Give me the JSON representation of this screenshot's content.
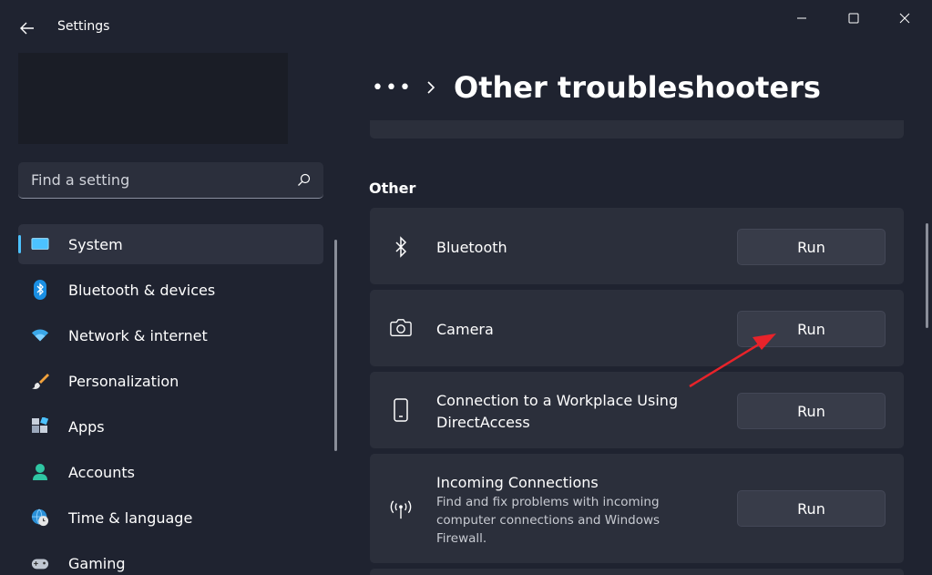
{
  "app": {
    "title": "Settings"
  },
  "search": {
    "placeholder": "Find a setting"
  },
  "sidebar": {
    "items": [
      {
        "label": "System",
        "icon": "monitor-icon",
        "active": true
      },
      {
        "label": "Bluetooth & devices",
        "icon": "bluetooth-icon"
      },
      {
        "label": "Network & internet",
        "icon": "wifi-icon"
      },
      {
        "label": "Personalization",
        "icon": "brush-icon"
      },
      {
        "label": "Apps",
        "icon": "apps-icon"
      },
      {
        "label": "Accounts",
        "icon": "person-icon"
      },
      {
        "label": "Time & language",
        "icon": "globe-clock-icon"
      },
      {
        "label": "Gaming",
        "icon": "gamepad-icon"
      }
    ]
  },
  "header": {
    "breadcrumb_more": "•••",
    "title": "Other troubleshooters"
  },
  "main": {
    "section_title": "Other",
    "troubleshooters": [
      {
        "title": "Bluetooth",
        "icon": "bluetooth-icon",
        "button": "Run"
      },
      {
        "title": "Camera",
        "icon": "camera-icon",
        "button": "Run"
      },
      {
        "title": "Connection to a Workplace Using DirectAccess",
        "icon": "phone-device-icon",
        "button": "Run"
      },
      {
        "title": "Incoming Connections",
        "description": "Find and fix problems with incoming computer connections and Windows Firewall.",
        "icon": "antenna-icon",
        "button": "Run"
      }
    ]
  },
  "colors": {
    "accent": "#4cc2ff",
    "annotation_arrow": "#e8232a",
    "background": "#1f2330",
    "card": "#2b2f3b"
  }
}
